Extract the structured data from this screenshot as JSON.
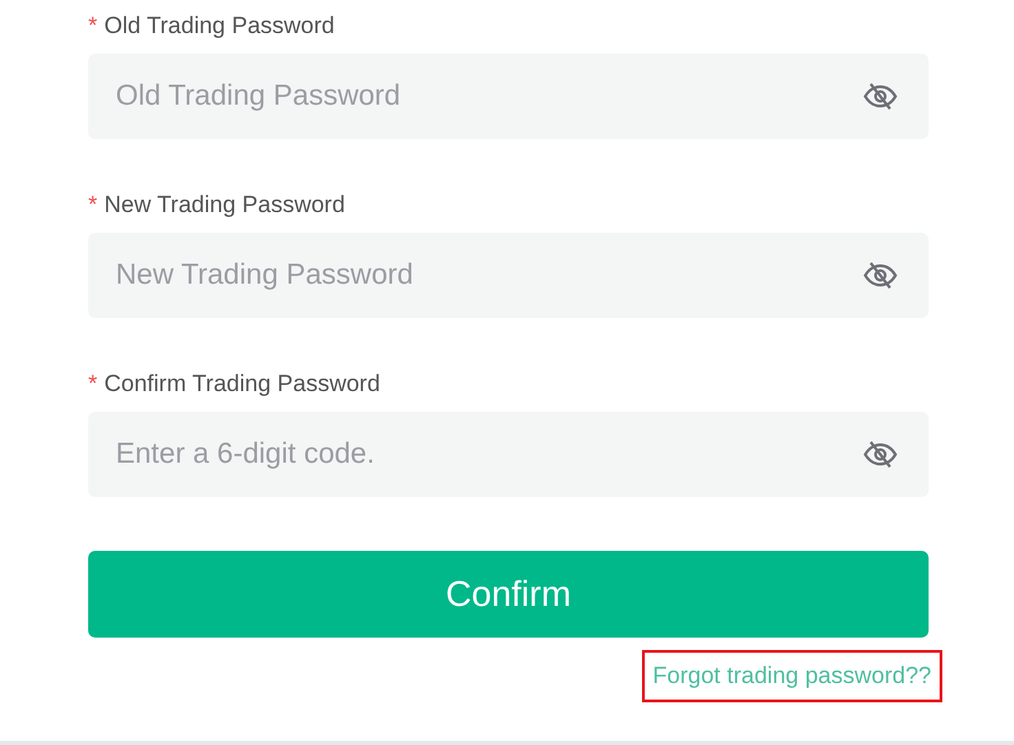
{
  "fields": [
    {
      "label": "Old Trading Password",
      "required": true,
      "placeholder": "Old Trading Password",
      "asterisk": "*"
    },
    {
      "label": "New Trading Password",
      "required": true,
      "placeholder": "New Trading Password",
      "asterisk": "*"
    },
    {
      "label": "Confirm Trading Password",
      "required": true,
      "placeholder": "Enter a 6-digit code.",
      "asterisk": "*"
    }
  ],
  "confirm_button": "Confirm",
  "forgot_link": {
    "text": "Forgot trading password??",
    "highlighted": true
  }
}
